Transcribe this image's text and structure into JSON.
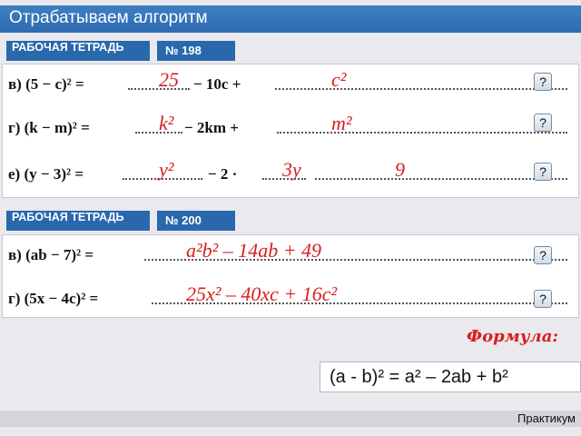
{
  "title": "Отрабатываем алгоритм",
  "section1": {
    "workbook_label": "РАБОЧАЯ ТЕТРАДЬ",
    "number": "№ 198",
    "rows": [
      {
        "letter": "в)",
        "expr": "(5 − c)² =",
        "mid": "− 10c +",
        "answers": [
          "25",
          "c²"
        ],
        "help": "?"
      },
      {
        "letter": "г)",
        "expr": "(k − m)² =",
        "mid": "− 2km +",
        "answers": [
          "k²",
          "m²"
        ],
        "help": "?"
      },
      {
        "letter": "е)",
        "expr": "(y − 3)² =",
        "mid": "− 2 ·",
        "answers": [
          "y²",
          "3y",
          "9"
        ],
        "help": "?"
      }
    ]
  },
  "section2": {
    "workbook_label": "РАБОЧАЯ ТЕТРАДЬ",
    "number": "№ 200",
    "rows": [
      {
        "letter": "в)",
        "expr": "(ab − 7)² =",
        "answer": "a²b² – 14ab + 49",
        "help": "?"
      },
      {
        "letter": "г)",
        "expr": "(5x − 4c)² =",
        "answer": "25x² – 40xc + 16c²",
        "help": "?"
      }
    ]
  },
  "formula": {
    "label": "Формула:",
    "text": "(a - b)² = a² – 2ab + b²"
  },
  "footer": {
    "label": "Практикум"
  },
  "colors": {
    "header_blue": "#2e6ab0",
    "answer_red": "#d81e1e"
  }
}
